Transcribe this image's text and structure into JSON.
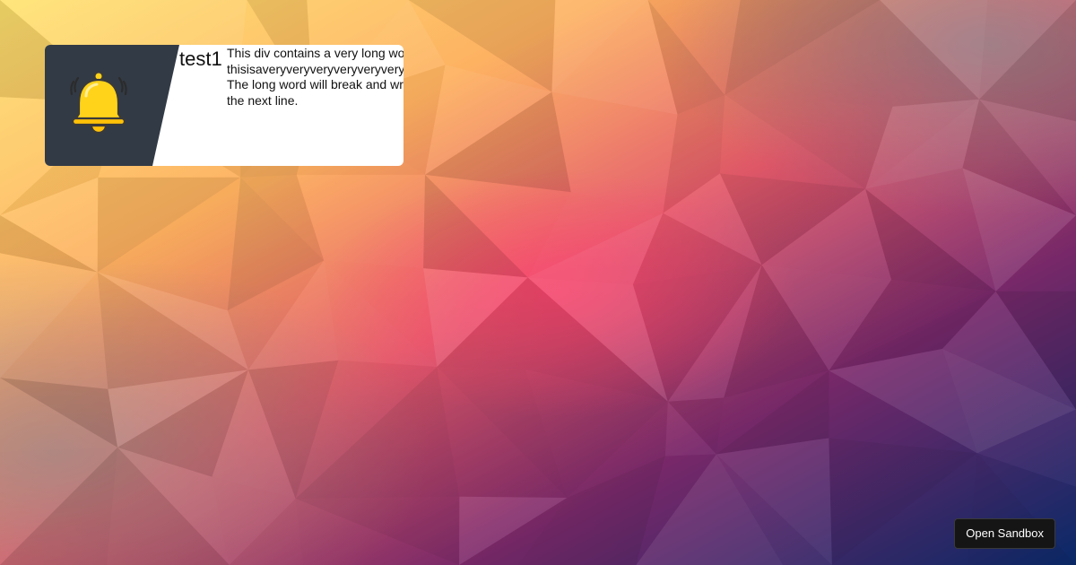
{
  "notification": {
    "icon": "bell-icon",
    "title": "test1",
    "message_lines": [
      "This div contains a very long word:",
      "thisisaveryveryveryveryveryverylongword.",
      "The long word will break and wrap to",
      "the next line."
    ]
  },
  "sandbox": {
    "label": "Open Sandbox"
  },
  "colors": {
    "icon_panel": "#323a45",
    "card": "#ffffff",
    "bell_body": "#ffd31a",
    "bell_outline": "#3a3a3a",
    "button_bg": "#151515"
  }
}
